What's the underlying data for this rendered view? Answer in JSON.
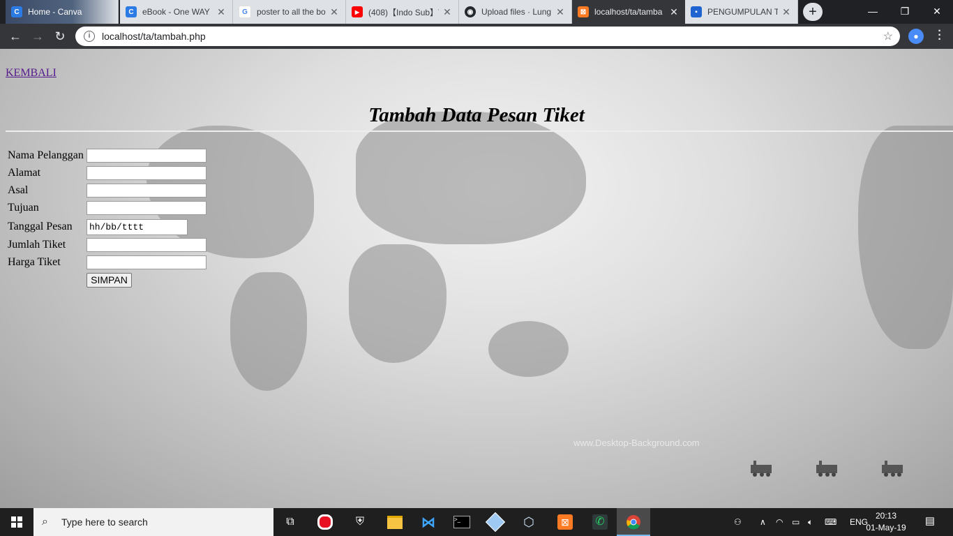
{
  "browser": {
    "tabs": [
      {
        "title": "Home - Canva",
        "icon": "canva-icon",
        "color": "#2c7be5",
        "glyph": "C"
      },
      {
        "title": "eBook - One WAY",
        "icon": "canva-icon",
        "color": "#2c7be5",
        "glyph": "C"
      },
      {
        "title": "poster to all the bo",
        "icon": "google-icon",
        "color": "#ffffff",
        "glyph": "G"
      },
      {
        "title": "(408)【Indo Sub】T",
        "icon": "youtube-icon",
        "color": "#ff0000",
        "glyph": "▶"
      },
      {
        "title": "Upload files · Lung",
        "icon": "github-icon",
        "color": "#24292e",
        "glyph": "◉"
      },
      {
        "title": "localhost/ta/tamba",
        "icon": "xampp-icon",
        "color": "#fb7a24",
        "glyph": "⊠"
      },
      {
        "title": "PENGUMPULAN T",
        "icon": "classroom-icon",
        "color": "#1e63d0",
        "glyph": "▪"
      }
    ],
    "active_tab_index": 5,
    "url": "localhost/ta/tambah.php"
  },
  "page": {
    "back_link": "KEMBALI",
    "heading": "Tambah Data Pesan Tiket",
    "form": {
      "fields": [
        {
          "label": "Nama Pelanggan",
          "value": "",
          "type": "text"
        },
        {
          "label": "Alamat",
          "value": "",
          "type": "text"
        },
        {
          "label": "Asal",
          "value": "",
          "type": "text"
        },
        {
          "label": "Tujuan",
          "value": "",
          "type": "text"
        },
        {
          "label": "Tanggal Pesan",
          "value": "",
          "placeholder": "hh/bb/tttt",
          "type": "date"
        },
        {
          "label": "Jumlah Tiket",
          "value": "",
          "type": "text"
        },
        {
          "label": "Harga Tiket",
          "value": "",
          "type": "text"
        }
      ],
      "submit_label": "SIMPAN"
    },
    "background_watermark": "www.Desktop-Background.com"
  },
  "taskbar": {
    "search_placeholder": "Type here to search",
    "language": "ENG",
    "time": "20:13",
    "date": "01-May-19"
  }
}
